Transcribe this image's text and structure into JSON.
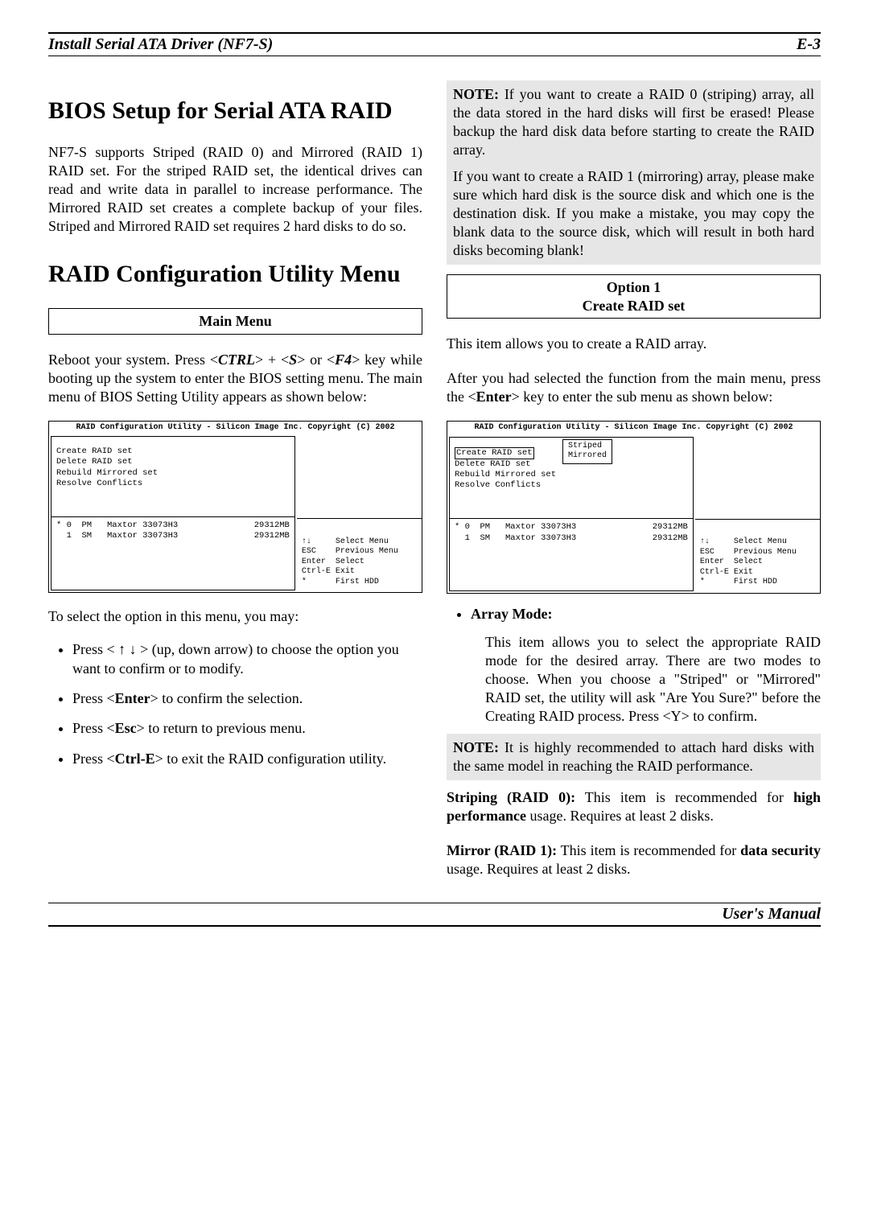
{
  "header": {
    "left": "Install Serial ATA Driver (NF7-S)",
    "right": "E-3"
  },
  "footer": {
    "right": "User's Manual"
  },
  "left_col": {
    "h1a": "BIOS Setup for Serial ATA RAID",
    "p1": "NF7-S supports Striped (RAID 0) and Mirrored (RAID 1) RAID set. For the striped RAID set, the identical drives can read and write data in parallel to increase performance. The Mirrored RAID set creates a complete backup of your files. Striped and Mirrored RAID set requires 2 hard disks to do so.",
    "h1b": "RAID Configuration Utility Menu",
    "main_menu_label": "Main Menu",
    "p2a": "Reboot your system. Press <",
    "p2b": "CTRL",
    "p2c": "> + <",
    "p2d": "S",
    "p2e": "> or <",
    "p2f": "F4",
    "p2g": "> key while booting up the system to enter the BIOS setting menu. The main menu of BIOS Setting Utility appears as shown below:",
    "ss1": {
      "title": "RAID Configuration Utility - Silicon Image Inc. Copyright (C) 2002",
      "menu": [
        "Create RAID set",
        "Delete RAID set",
        "Rebuild Mirrored set",
        "Resolve Conflicts"
      ],
      "disks": [
        "* 0  PM   Maxtor 33073H3               29312MB",
        "  1  SM   Maxtor 33073H3               29312MB"
      ],
      "legend": [
        [
          "↑↓",
          "Select Menu"
        ],
        [
          "ESC",
          "Previous Menu"
        ],
        [
          "Enter",
          "Select"
        ],
        [
          "Ctrl-E",
          "Exit"
        ],
        [
          "",
          ""
        ],
        [
          "*",
          "First HDD"
        ]
      ]
    },
    "p3": "To select the option in this menu, you may:",
    "bullets": [
      {
        "pre": "Press < ↑  ↓ > (up, down arrow) to choose the option you want to confirm or to modify."
      },
      {
        "pre": "Press <",
        "key": "Enter",
        "post": "> to confirm the selection."
      },
      {
        "pre": "Press <",
        "key": "Esc",
        "post": "> to return to previous menu."
      },
      {
        "pre": "Press <",
        "key": "Ctrl-E",
        "post": "> to exit the RAID configuration utility."
      }
    ]
  },
  "right_col": {
    "note1a": "NOTE:",
    "note1b": " If you want to create a RAID 0 (striping) array, all the data stored in the hard disks will first be erased! Please backup the hard disk data before starting to create the RAID array.",
    "note1c": "If you want to create a RAID 1 (mirroring) array, please make sure which hard disk is the source disk and which one is the destination disk. If you make a mistake, you may copy the blank data to the source disk, which will result in both hard disks becoming blank!",
    "opt1_line1": "Option 1",
    "opt1_line2": "Create RAID set",
    "p_opt1": "This item allows you to create a RAID array.",
    "p_opt1b_a": "After you had selected the function from the main menu, press the <",
    "p_opt1b_key": "Enter",
    "p_opt1b_b": "> key to enter the sub menu as shown below:",
    "ss2": {
      "title": "RAID Configuration Utility - Silicon Image Inc. Copyright (C) 2002",
      "menu": [
        "Create RAID set",
        "Delete RAID set",
        "Rebuild Mirrored set",
        "Resolve Conflicts"
      ],
      "submenu": [
        "Striped",
        "Mirrored"
      ],
      "disks": [
        "* 0  PM   Maxtor 33073H3               29312MB",
        "  1  SM   Maxtor 33073H3               29312MB"
      ],
      "legend": [
        [
          "↑↓",
          "Select Menu"
        ],
        [
          "ESC",
          "Previous Menu"
        ],
        [
          "Enter",
          "Select"
        ],
        [
          "Ctrl-E",
          "Exit"
        ],
        [
          "",
          ""
        ],
        [
          "*",
          "First HDD"
        ]
      ]
    },
    "array_mode_label": "Array Mode:",
    "array_mode_body": "This item allows you to select the appropriate RAID mode for the desired array. There are two modes to choose. When you choose a \"Striped\" or \"Mirrored\" RAID set, the utility will ask \"Are You Sure?\" before the Creating RAID process. Press <Y> to confirm.",
    "note2a": "NOTE:",
    "note2b": " It is highly recommended to attach hard disks with the same model in reaching the RAID performance.",
    "striping_label": "Striping (RAID 0):",
    "striping_body_a": " This item is recommended for ",
    "striping_body_b": "high performance",
    "striping_body_c": " usage. Requires at least 2 disks.",
    "mirror_label": "Mirror (RAID 1):",
    "mirror_body_a": " This item is recommended for ",
    "mirror_body_b": "data security",
    "mirror_body_c": " usage. Requires at least 2 disks."
  }
}
